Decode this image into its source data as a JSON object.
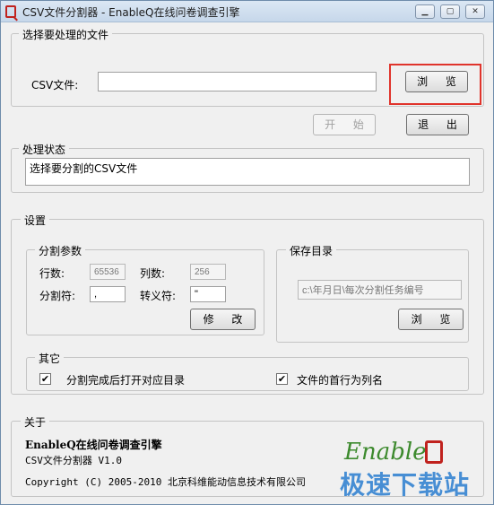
{
  "window": {
    "title": "CSV文件分割器 - EnableQ在线问卷调查引擎",
    "min_icon": "minimize-icon",
    "max_icon": "maximize-icon",
    "close_icon": "close-icon"
  },
  "file_group": {
    "legend": "选择要处理的文件",
    "csv_label": "CSV文件:",
    "csv_value": "",
    "browse_label": "浏 览"
  },
  "actions": {
    "start_label": "开 始",
    "exit_label": "退 出"
  },
  "status_group": {
    "legend": "处理状态",
    "text": "选择要分割的CSV文件"
  },
  "settings": {
    "legend": "设置",
    "split_params": {
      "legend": "分割参数",
      "rows_label": "行数:",
      "rows_value": "65536",
      "cols_label": "列数:",
      "cols_value": "256",
      "sep_label": "分割符:",
      "sep_value": ",",
      "esc_label": "转义符:",
      "esc_value": "\"",
      "modify_label": "修 改"
    },
    "save_dir": {
      "legend": "保存目录",
      "path": "c:\\年月日\\每次分割任务编号",
      "browse_label": "浏 览"
    },
    "other": {
      "legend": "其它",
      "open_dir_label": "分割完成后打开对应目录",
      "open_dir_checked": "✔",
      "header_label": "文件的首行为列名",
      "header_checked": "✔"
    }
  },
  "about": {
    "legend": "关于",
    "product": "EnableQ在线问卷调查引擎",
    "version": "CSV文件分割器  V1.0",
    "copyright": "Copyright (C) 2005-2010 北京科维能动信息技术有限公司",
    "logo_text": "Enable",
    "watermark": "极速下载站"
  },
  "colors": {
    "highlight": "#e0342c",
    "logo_green": "#3d8a2e",
    "logo_red": "#c0221e",
    "watermark_blue": "#2a7ed0"
  }
}
